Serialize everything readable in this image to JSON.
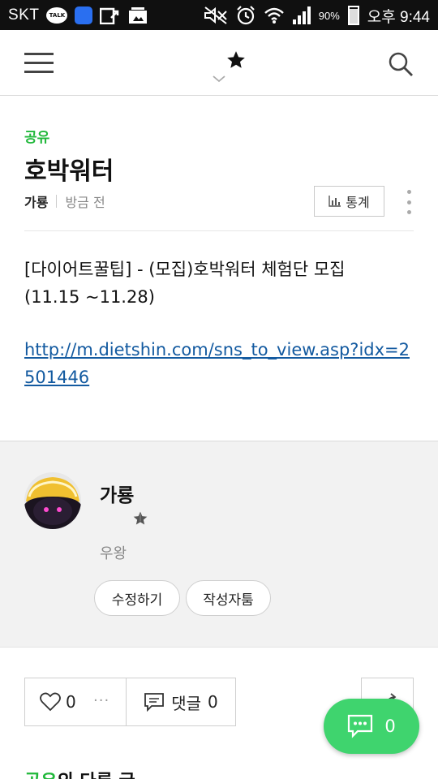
{
  "status_bar": {
    "carrier": "SKT",
    "talk_badge": "TALK",
    "battery_percent": "90%",
    "time": "오후 9:44",
    "icons": [
      "kakaotalk-icon",
      "app-icon",
      "upload-icon",
      "gallery-icon",
      "mute-icon",
      "alarm-icon",
      "wifi-icon",
      "signal-icon",
      "battery-icon"
    ]
  },
  "header": {
    "menu_icon": "hamburger-icon",
    "logo_icon": "star-icon",
    "dropdown_icon": "chevron-down-icon",
    "search_icon": "search-icon"
  },
  "post": {
    "category": "공유",
    "title": "호박워터",
    "author": "가룡",
    "time": "방금 전",
    "stats_label": "통계",
    "body_line1": "[다이어트꿀팁] - (모집)호박워터 체험단 모집",
    "body_line2": "(11.15 ~11.28)",
    "link": "http://m.dietshin.com/sns_to_view.asp?idx=2501446"
  },
  "author_card": {
    "name": "가룡",
    "description": "우왕",
    "edit_button": "수정하기",
    "author_button": "작성자툼"
  },
  "actions": {
    "like_count": "0",
    "like_more": "···",
    "comment_label": "댓글",
    "comment_count": "0",
    "float_comment_count": "0"
  },
  "more_posts": {
    "category": "공유",
    "suffix": "의 다른 글"
  },
  "colors": {
    "accent_green": "#21b83b",
    "float_button": "#3fd46e",
    "link": "#135aa0"
  }
}
